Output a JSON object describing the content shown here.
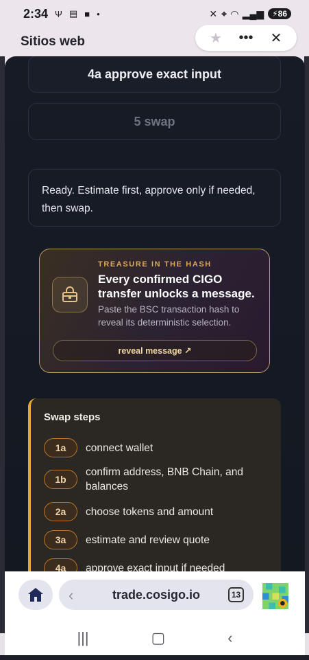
{
  "status_bar": {
    "time": "2:34",
    "battery": "86"
  },
  "background_app": {
    "title": "Sitios web"
  },
  "page": {
    "approve_button": "4a approve exact input",
    "swap_button": "5 swap",
    "info_text": "Ready. Estimate first, approve only if needed, then swap.",
    "promo": {
      "kicker": "TREASURE IN THE HASH",
      "title": "Every confirmed CIGO transfer unlocks a message.",
      "description": "Paste the BSC transaction hash to reveal its deterministic selection.",
      "button": "reveal message ↗"
    },
    "steps": {
      "title": "Swap steps",
      "items": [
        {
          "badge": "1a",
          "text": "connect wallet"
        },
        {
          "badge": "1b",
          "text": "confirm address, BNB Chain, and balances"
        },
        {
          "badge": "2a",
          "text": "choose tokens and amount"
        },
        {
          "badge": "3a",
          "text": "estimate and review quote"
        },
        {
          "badge": "4a",
          "text": "approve exact input if needed"
        }
      ]
    }
  },
  "browser": {
    "url": "trade.cosigo.io",
    "tab_count": "13"
  },
  "colors": {
    "accent_orange": "#e8a435",
    "promo_gold": "#d9a85a",
    "sheet_bg": "#171b26"
  }
}
